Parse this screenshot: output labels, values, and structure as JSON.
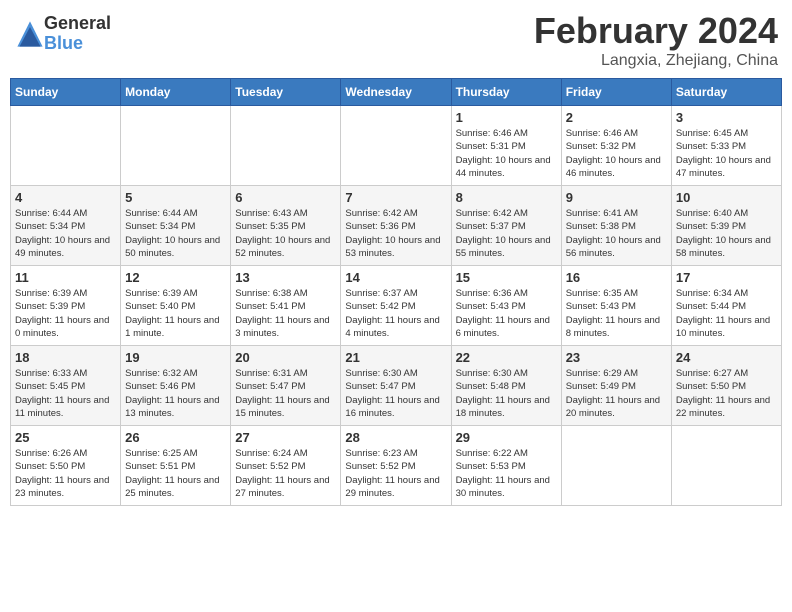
{
  "header": {
    "logo_general": "General",
    "logo_blue": "Blue",
    "title": "February 2024",
    "location": "Langxia, Zhejiang, China"
  },
  "weekdays": [
    "Sunday",
    "Monday",
    "Tuesday",
    "Wednesday",
    "Thursday",
    "Friday",
    "Saturday"
  ],
  "weeks": [
    [
      {
        "day": "",
        "info": ""
      },
      {
        "day": "",
        "info": ""
      },
      {
        "day": "",
        "info": ""
      },
      {
        "day": "",
        "info": ""
      },
      {
        "day": "1",
        "info": "Sunrise: 6:46 AM\nSunset: 5:31 PM\nDaylight: 10 hours\nand 44 minutes."
      },
      {
        "day": "2",
        "info": "Sunrise: 6:46 AM\nSunset: 5:32 PM\nDaylight: 10 hours\nand 46 minutes."
      },
      {
        "day": "3",
        "info": "Sunrise: 6:45 AM\nSunset: 5:33 PM\nDaylight: 10 hours\nand 47 minutes."
      }
    ],
    [
      {
        "day": "4",
        "info": "Sunrise: 6:44 AM\nSunset: 5:34 PM\nDaylight: 10 hours\nand 49 minutes."
      },
      {
        "day": "5",
        "info": "Sunrise: 6:44 AM\nSunset: 5:34 PM\nDaylight: 10 hours\nand 50 minutes."
      },
      {
        "day": "6",
        "info": "Sunrise: 6:43 AM\nSunset: 5:35 PM\nDaylight: 10 hours\nand 52 minutes."
      },
      {
        "day": "7",
        "info": "Sunrise: 6:42 AM\nSunset: 5:36 PM\nDaylight: 10 hours\nand 53 minutes."
      },
      {
        "day": "8",
        "info": "Sunrise: 6:42 AM\nSunset: 5:37 PM\nDaylight: 10 hours\nand 55 minutes."
      },
      {
        "day": "9",
        "info": "Sunrise: 6:41 AM\nSunset: 5:38 PM\nDaylight: 10 hours\nand 56 minutes."
      },
      {
        "day": "10",
        "info": "Sunrise: 6:40 AM\nSunset: 5:39 PM\nDaylight: 10 hours\nand 58 minutes."
      }
    ],
    [
      {
        "day": "11",
        "info": "Sunrise: 6:39 AM\nSunset: 5:39 PM\nDaylight: 11 hours\nand 0 minutes."
      },
      {
        "day": "12",
        "info": "Sunrise: 6:39 AM\nSunset: 5:40 PM\nDaylight: 11 hours\nand 1 minute."
      },
      {
        "day": "13",
        "info": "Sunrise: 6:38 AM\nSunset: 5:41 PM\nDaylight: 11 hours\nand 3 minutes."
      },
      {
        "day": "14",
        "info": "Sunrise: 6:37 AM\nSunset: 5:42 PM\nDaylight: 11 hours\nand 4 minutes."
      },
      {
        "day": "15",
        "info": "Sunrise: 6:36 AM\nSunset: 5:43 PM\nDaylight: 11 hours\nand 6 minutes."
      },
      {
        "day": "16",
        "info": "Sunrise: 6:35 AM\nSunset: 5:43 PM\nDaylight: 11 hours\nand 8 minutes."
      },
      {
        "day": "17",
        "info": "Sunrise: 6:34 AM\nSunset: 5:44 PM\nDaylight: 11 hours\nand 10 minutes."
      }
    ],
    [
      {
        "day": "18",
        "info": "Sunrise: 6:33 AM\nSunset: 5:45 PM\nDaylight: 11 hours\nand 11 minutes."
      },
      {
        "day": "19",
        "info": "Sunrise: 6:32 AM\nSunset: 5:46 PM\nDaylight: 11 hours\nand 13 minutes."
      },
      {
        "day": "20",
        "info": "Sunrise: 6:31 AM\nSunset: 5:47 PM\nDaylight: 11 hours\nand 15 minutes."
      },
      {
        "day": "21",
        "info": "Sunrise: 6:30 AM\nSunset: 5:47 PM\nDaylight: 11 hours\nand 16 minutes."
      },
      {
        "day": "22",
        "info": "Sunrise: 6:30 AM\nSunset: 5:48 PM\nDaylight: 11 hours\nand 18 minutes."
      },
      {
        "day": "23",
        "info": "Sunrise: 6:29 AM\nSunset: 5:49 PM\nDaylight: 11 hours\nand 20 minutes."
      },
      {
        "day": "24",
        "info": "Sunrise: 6:27 AM\nSunset: 5:50 PM\nDaylight: 11 hours\nand 22 minutes."
      }
    ],
    [
      {
        "day": "25",
        "info": "Sunrise: 6:26 AM\nSunset: 5:50 PM\nDaylight: 11 hours\nand 23 minutes."
      },
      {
        "day": "26",
        "info": "Sunrise: 6:25 AM\nSunset: 5:51 PM\nDaylight: 11 hours\nand 25 minutes."
      },
      {
        "day": "27",
        "info": "Sunrise: 6:24 AM\nSunset: 5:52 PM\nDaylight: 11 hours\nand 27 minutes."
      },
      {
        "day": "28",
        "info": "Sunrise: 6:23 AM\nSunset: 5:52 PM\nDaylight: 11 hours\nand 29 minutes."
      },
      {
        "day": "29",
        "info": "Sunrise: 6:22 AM\nSunset: 5:53 PM\nDaylight: 11 hours\nand 30 minutes."
      },
      {
        "day": "",
        "info": ""
      },
      {
        "day": "",
        "info": ""
      }
    ]
  ]
}
